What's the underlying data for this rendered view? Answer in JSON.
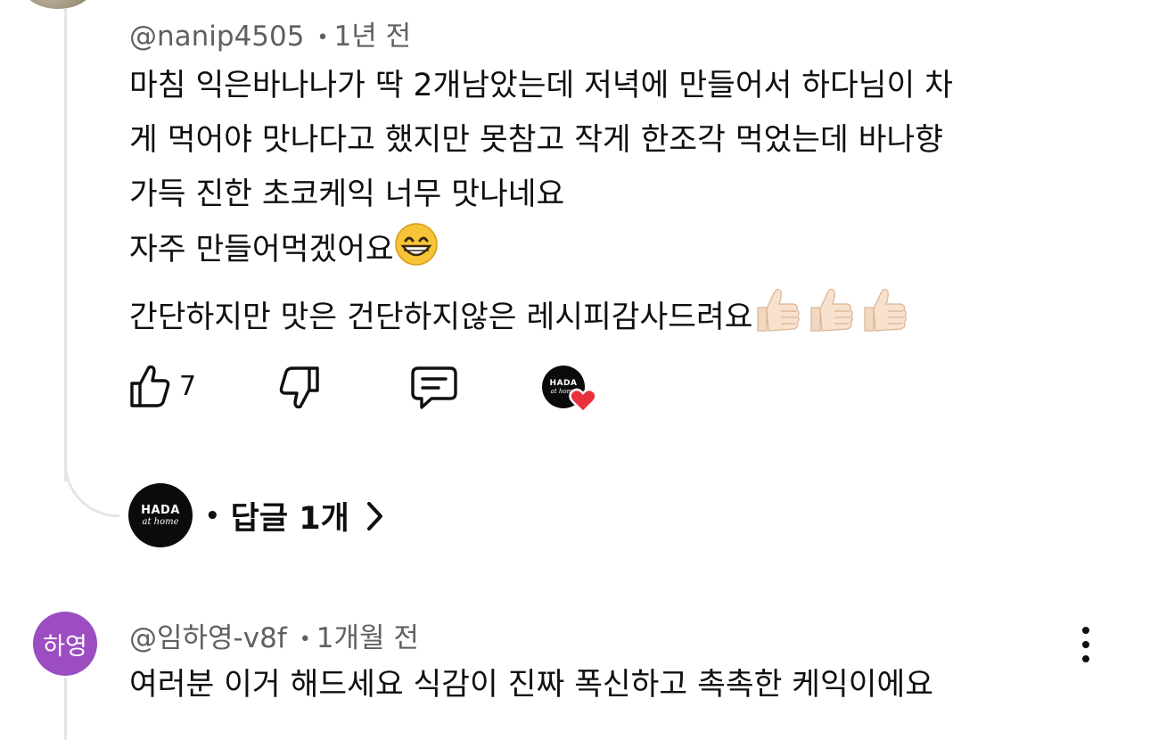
{
  "comment1": {
    "handle": "@nanip4505",
    "time": "1년 전",
    "lines": [
      "마침 익은바나나가 딱 2개남았는데 저녁에 만들어서  하다님이 차",
      "게 먹어야 맛나다고 했지만 못참고 작게 한조각 먹었는데   바나향",
      "가득 진한 초코케익 너무 맛나네요",
      "자주 만들어먹겠어요",
      "간단하지만 맛은 건단하지않은 레시피감사드려요"
    ],
    "emoji_grin": "😁",
    "emoji_thumbs": "👍🏻👍🏻👍🏻",
    "like_count": "7",
    "hearted_by_logo": {
      "line1": "HADA",
      "line2": "at home"
    },
    "replies_logo": {
      "line1": "HADA",
      "line2": "at home"
    },
    "replies_label": "답글 1개",
    "heart_color": "#e8313c"
  },
  "comment2": {
    "avatar_text": "하영",
    "avatar_color": "#9c4dc1",
    "handle": "@임하영-v8f",
    "time": "1개월 전",
    "text": "여러분 이거 해드세요 식감이 진짜 폭신하고 촉촉한 케익이에요"
  },
  "icons": {
    "like": "thumbs-up-icon",
    "dislike": "thumbs-down-icon",
    "reply": "comment-icon",
    "more": "more-vertical-icon",
    "chevron": "chevron-right-icon"
  }
}
